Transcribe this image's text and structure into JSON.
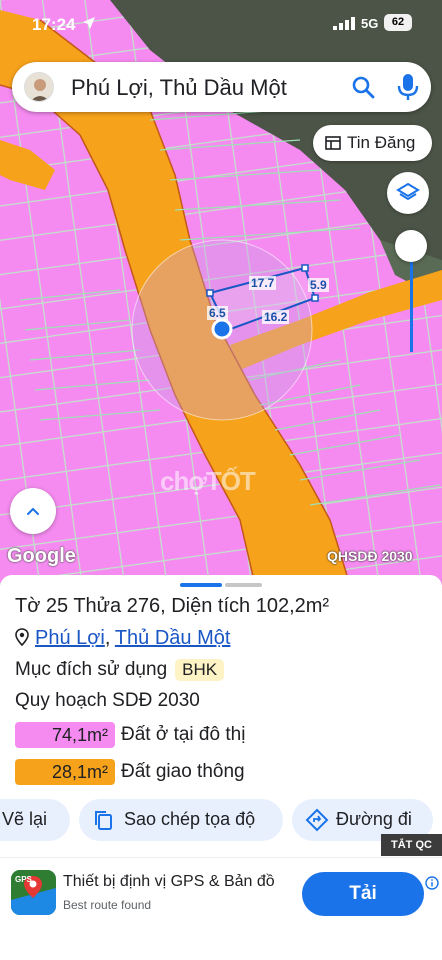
{
  "status_bar": {
    "time": "17:24",
    "network": "5G",
    "battery": "62"
  },
  "search": {
    "query": "Phú Lợi, Thủ Dầu Một"
  },
  "map": {
    "post_button_label": "Tin Đăng",
    "dimensions": [
      "17.7",
      "5.9",
      "6.5",
      "16.2"
    ],
    "watermark": "chợTỐT",
    "attribution": "Google",
    "layer_name": "QHSDĐ 2030",
    "colors": {
      "residential": "#f58bf0",
      "transport": "#f7a21b",
      "user_dot": "#1a73e8"
    }
  },
  "parcel": {
    "title": "Tờ 25 Thửa 276, Diện tích 102,2m²",
    "ward": "Phú Lợi",
    "separator": ",",
    "city": "Thủ Dầu Một",
    "purpose_label": "Mục đích sử dụng",
    "purpose_code": "BHK",
    "plan_label": "Quy hoạch SDĐ 2030",
    "legend": [
      {
        "area": "74,1m²",
        "label": "Đất ở tại đô thị",
        "color": "#f58bf0"
      },
      {
        "area": "28,1m²",
        "label": "Đất giao thông",
        "color": "#f7a21b"
      }
    ]
  },
  "actions": {
    "redraw": "Vẽ lại",
    "copy_coords": "Sao chép tọa độ",
    "directions": "Đường đi"
  },
  "ad": {
    "tag": "TẮT QC",
    "title": "Thiết bị định vị GPS & Bản đồ",
    "subtitle": "Best route found",
    "cta": "Tải",
    "icon_text": "GPS"
  }
}
